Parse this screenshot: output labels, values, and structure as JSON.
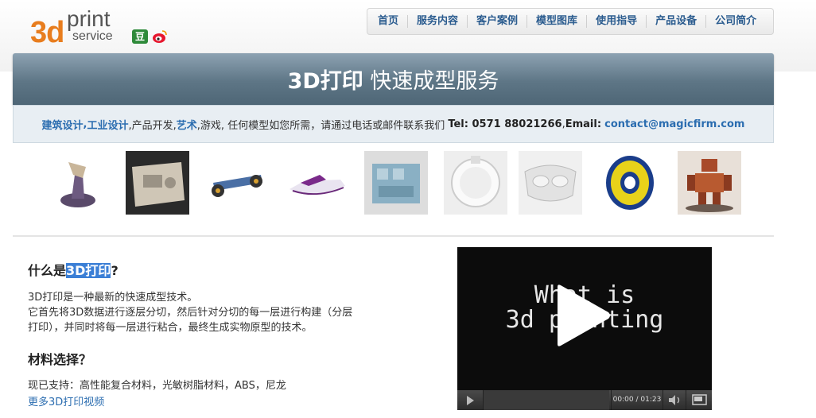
{
  "logo": {
    "part1": "3d",
    "part2": "print",
    "part3": "service"
  },
  "social": {
    "douban_glyph": "豆",
    "icons": [
      "douban-icon",
      "weibo-icon"
    ]
  },
  "nav": {
    "items": [
      "首页",
      "服务内容",
      "客户案例",
      "模型图库",
      "使用指导",
      "产品设备",
      "公司简介"
    ]
  },
  "banner": {
    "title_bold": "3D打印",
    "title_rest": " 快速成型服务"
  },
  "contact": {
    "kw1": "建筑设计",
    "sep1": ",",
    "kw2": "工业设计",
    "plain1": ",产品开发,",
    "kw3": "艺术",
    "plain2": ",游戏, 任何模型如您所需，请通过电话或邮件联系我们",
    "tel": "Tel: 0571 88021266",
    "plain3": " , ",
    "email_label": "Email:",
    "email": "contact@magicfirm.com"
  },
  "thumbnails": [
    "joystick-model",
    "mold-part",
    "car-chassis",
    "jet-ski",
    "engine-block",
    "white-ring-part",
    "face-mask",
    "yellow-wheel",
    "robot-figure"
  ],
  "section1": {
    "heading_prefix": "什么是",
    "heading_highlight": "3D打印",
    "heading_suffix": "?",
    "line1": "3D打印是一种最新的快速成型技术。",
    "line2": "它首先将3D数据进行逐层分切，然后针对分切的每一层进行构建（分层",
    "line3": "打印），并同时将每一层进行粘合，最终生成实物原型的技术。"
  },
  "section2": {
    "heading": "材料选择？",
    "line1": "现已支持：高性能复合材料，光敏树脂材料，ABS，尼龙",
    "more_link": "更多3D打印视频"
  },
  "video": {
    "line1": "What is",
    "line2": "3d printing",
    "time": "00:00 / 01:23"
  }
}
